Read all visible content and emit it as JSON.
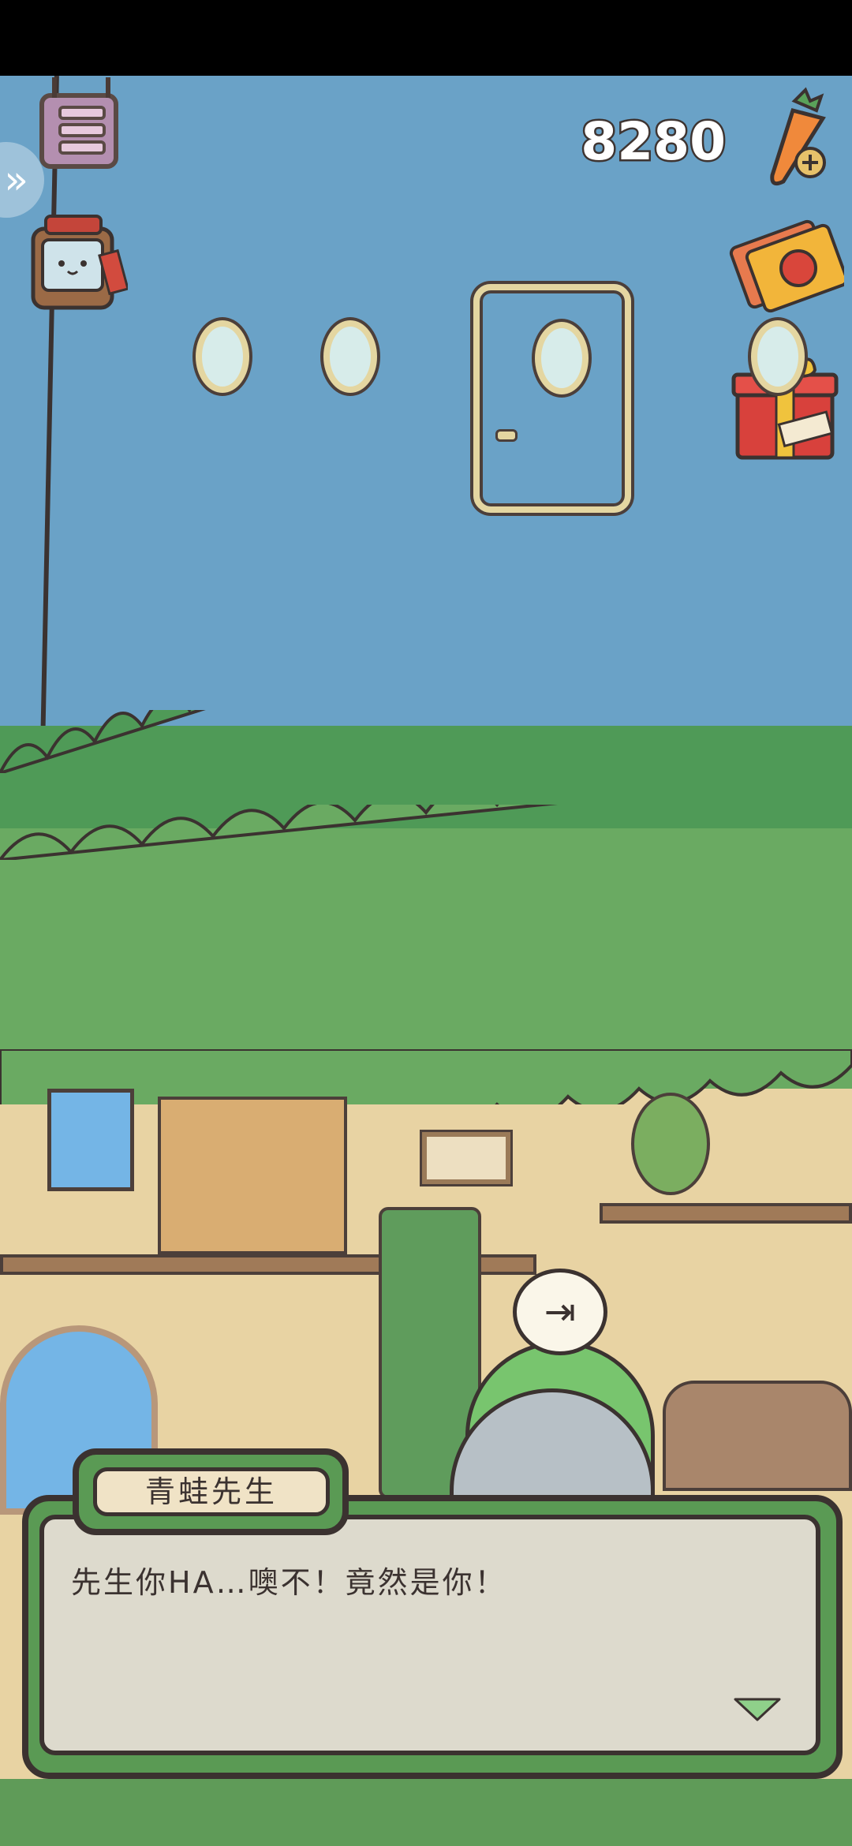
{
  "hud": {
    "currency_count": "8280",
    "currency_icon": "carrot-plus-icon",
    "menu_icon": "menu-icon",
    "side_icon": "double-chevron-right-icon",
    "backpack_icon": "backpack-icon",
    "ticket_icon": "lucky-ticket-icon",
    "gift_icon": "gift-box-icon"
  },
  "scene": {
    "exit_icon": "exit-door-icon"
  },
  "dialog": {
    "speaker": "青蛙先生",
    "text": "先生你HA…噢不！竟然是你！",
    "continue_icon": "triangle-down-icon"
  },
  "colors": {
    "sky": "#6aa2c7",
    "foliage": "#6aaa62",
    "dialog_frame": "#5a9a54",
    "outline": "#3b3230"
  }
}
